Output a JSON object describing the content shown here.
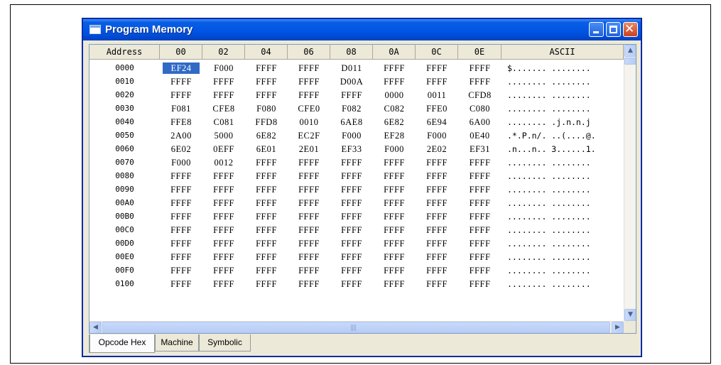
{
  "window": {
    "title": "Program Memory",
    "title_icon": "window-icon"
  },
  "columns": [
    "Address",
    "00",
    "02",
    "04",
    "06",
    "08",
    "0A",
    "0C",
    "0E",
    "ASCII"
  ],
  "selected_cell": {
    "row": 0,
    "col": 0
  },
  "rows": [
    {
      "address": "0000",
      "words": [
        "EF24",
        "F000",
        "FFFF",
        "FFFF",
        "D011",
        "FFFF",
        "FFFF",
        "FFFF"
      ],
      "ascii": "$....... ........"
    },
    {
      "address": "0010",
      "words": [
        "FFFF",
        "FFFF",
        "FFFF",
        "FFFF",
        "D00A",
        "FFFF",
        "FFFF",
        "FFFF"
      ],
      "ascii": "........ ........"
    },
    {
      "address": "0020",
      "words": [
        "FFFF",
        "FFFF",
        "FFFF",
        "FFFF",
        "FFFF",
        "0000",
        "0011",
        "CFD8"
      ],
      "ascii": "........ ........"
    },
    {
      "address": "0030",
      "words": [
        "F081",
        "CFE8",
        "F080",
        "CFE0",
        "F082",
        "C082",
        "FFE0",
        "C080"
      ],
      "ascii": "........ ........"
    },
    {
      "address": "0040",
      "words": [
        "FFE8",
        "C081",
        "FFD8",
        "0010",
        "6AE8",
        "6E82",
        "6E94",
        "6A00"
      ],
      "ascii": "........ .j.n.n.j"
    },
    {
      "address": "0050",
      "words": [
        "2A00",
        "5000",
        "6E82",
        "EC2F",
        "F000",
        "EF28",
        "F000",
        "0E40"
      ],
      "ascii": ".*.P.n/. ..(....@."
    },
    {
      "address": "0060",
      "words": [
        "6E02",
        "0EFF",
        "6E01",
        "2E01",
        "EF33",
        "F000",
        "2E02",
        "EF31"
      ],
      "ascii": ".n...n.. 3......1."
    },
    {
      "address": "0070",
      "words": [
        "F000",
        "0012",
        "FFFF",
        "FFFF",
        "FFFF",
        "FFFF",
        "FFFF",
        "FFFF"
      ],
      "ascii": "........ ........"
    },
    {
      "address": "0080",
      "words": [
        "FFFF",
        "FFFF",
        "FFFF",
        "FFFF",
        "FFFF",
        "FFFF",
        "FFFF",
        "FFFF"
      ],
      "ascii": "........ ........"
    },
    {
      "address": "0090",
      "words": [
        "FFFF",
        "FFFF",
        "FFFF",
        "FFFF",
        "FFFF",
        "FFFF",
        "FFFF",
        "FFFF"
      ],
      "ascii": "........ ........"
    },
    {
      "address": "00A0",
      "words": [
        "FFFF",
        "FFFF",
        "FFFF",
        "FFFF",
        "FFFF",
        "FFFF",
        "FFFF",
        "FFFF"
      ],
      "ascii": "........ ........"
    },
    {
      "address": "00B0",
      "words": [
        "FFFF",
        "FFFF",
        "FFFF",
        "FFFF",
        "FFFF",
        "FFFF",
        "FFFF",
        "FFFF"
      ],
      "ascii": "........ ........"
    },
    {
      "address": "00C0",
      "words": [
        "FFFF",
        "FFFF",
        "FFFF",
        "FFFF",
        "FFFF",
        "FFFF",
        "FFFF",
        "FFFF"
      ],
      "ascii": "........ ........"
    },
    {
      "address": "00D0",
      "words": [
        "FFFF",
        "FFFF",
        "FFFF",
        "FFFF",
        "FFFF",
        "FFFF",
        "FFFF",
        "FFFF"
      ],
      "ascii": "........ ........"
    },
    {
      "address": "00E0",
      "words": [
        "FFFF",
        "FFFF",
        "FFFF",
        "FFFF",
        "FFFF",
        "FFFF",
        "FFFF",
        "FFFF"
      ],
      "ascii": "........ ........"
    },
    {
      "address": "00F0",
      "words": [
        "FFFF",
        "FFFF",
        "FFFF",
        "FFFF",
        "FFFF",
        "FFFF",
        "FFFF",
        "FFFF"
      ],
      "ascii": "........ ........"
    },
    {
      "address": "0100",
      "words": [
        "FFFF",
        "FFFF",
        "FFFF",
        "FFFF",
        "FFFF",
        "FFFF",
        "FFFF",
        "FFFF"
      ],
      "ascii": "........ ........"
    }
  ],
  "tabs": [
    {
      "label": "Opcode Hex",
      "active": true
    },
    {
      "label": "Machine",
      "active": false
    },
    {
      "label": "Symbolic",
      "active": false
    }
  ],
  "colors": {
    "titlebar": "#0055e5",
    "selection": "#316ac5",
    "close_button": "#c9401e"
  }
}
